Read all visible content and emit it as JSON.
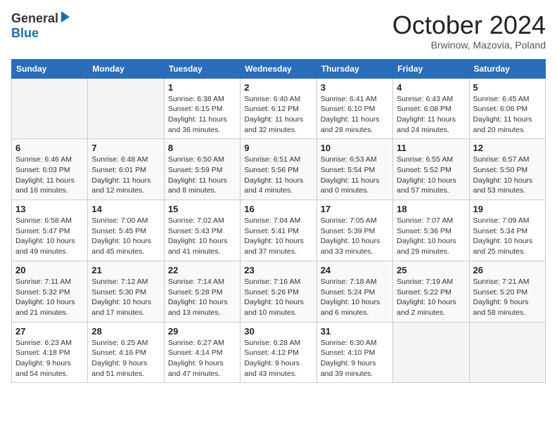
{
  "header": {
    "logo_general": "General",
    "logo_blue": "Blue",
    "month_title": "October 2024",
    "location": "Brwinow, Mazovia, Poland"
  },
  "days_of_week": [
    "Sunday",
    "Monday",
    "Tuesday",
    "Wednesday",
    "Thursday",
    "Friday",
    "Saturday"
  ],
  "weeks": [
    [
      {
        "day": "",
        "info": ""
      },
      {
        "day": "",
        "info": ""
      },
      {
        "day": "1",
        "info": "Sunrise: 6:38 AM\nSunset: 6:15 PM\nDaylight: 11 hours\nand 36 minutes."
      },
      {
        "day": "2",
        "info": "Sunrise: 6:40 AM\nSunset: 6:12 PM\nDaylight: 11 hours\nand 32 minutes."
      },
      {
        "day": "3",
        "info": "Sunrise: 6:41 AM\nSunset: 6:10 PM\nDaylight: 11 hours\nand 28 minutes."
      },
      {
        "day": "4",
        "info": "Sunrise: 6:43 AM\nSunset: 6:08 PM\nDaylight: 11 hours\nand 24 minutes."
      },
      {
        "day": "5",
        "info": "Sunrise: 6:45 AM\nSunset: 6:06 PM\nDaylight: 11 hours\nand 20 minutes."
      }
    ],
    [
      {
        "day": "6",
        "info": "Sunrise: 6:46 AM\nSunset: 6:03 PM\nDaylight: 11 hours\nand 16 minutes."
      },
      {
        "day": "7",
        "info": "Sunrise: 6:48 AM\nSunset: 6:01 PM\nDaylight: 11 hours\nand 12 minutes."
      },
      {
        "day": "8",
        "info": "Sunrise: 6:50 AM\nSunset: 5:59 PM\nDaylight: 11 hours\nand 8 minutes."
      },
      {
        "day": "9",
        "info": "Sunrise: 6:51 AM\nSunset: 5:56 PM\nDaylight: 11 hours\nand 4 minutes."
      },
      {
        "day": "10",
        "info": "Sunrise: 6:53 AM\nSunset: 5:54 PM\nDaylight: 11 hours\nand 0 minutes."
      },
      {
        "day": "11",
        "info": "Sunrise: 6:55 AM\nSunset: 5:52 PM\nDaylight: 10 hours\nand 57 minutes."
      },
      {
        "day": "12",
        "info": "Sunrise: 6:57 AM\nSunset: 5:50 PM\nDaylight: 10 hours\nand 53 minutes."
      }
    ],
    [
      {
        "day": "13",
        "info": "Sunrise: 6:58 AM\nSunset: 5:47 PM\nDaylight: 10 hours\nand 49 minutes."
      },
      {
        "day": "14",
        "info": "Sunrise: 7:00 AM\nSunset: 5:45 PM\nDaylight: 10 hours\nand 45 minutes."
      },
      {
        "day": "15",
        "info": "Sunrise: 7:02 AM\nSunset: 5:43 PM\nDaylight: 10 hours\nand 41 minutes."
      },
      {
        "day": "16",
        "info": "Sunrise: 7:04 AM\nSunset: 5:41 PM\nDaylight: 10 hours\nand 37 minutes."
      },
      {
        "day": "17",
        "info": "Sunrise: 7:05 AM\nSunset: 5:39 PM\nDaylight: 10 hours\nand 33 minutes."
      },
      {
        "day": "18",
        "info": "Sunrise: 7:07 AM\nSunset: 5:36 PM\nDaylight: 10 hours\nand 29 minutes."
      },
      {
        "day": "19",
        "info": "Sunrise: 7:09 AM\nSunset: 5:34 PM\nDaylight: 10 hours\nand 25 minutes."
      }
    ],
    [
      {
        "day": "20",
        "info": "Sunrise: 7:11 AM\nSunset: 5:32 PM\nDaylight: 10 hours\nand 21 minutes."
      },
      {
        "day": "21",
        "info": "Sunrise: 7:12 AM\nSunset: 5:30 PM\nDaylight: 10 hours\nand 17 minutes."
      },
      {
        "day": "22",
        "info": "Sunrise: 7:14 AM\nSunset: 5:28 PM\nDaylight: 10 hours\nand 13 minutes."
      },
      {
        "day": "23",
        "info": "Sunrise: 7:16 AM\nSunset: 5:26 PM\nDaylight: 10 hours\nand 10 minutes."
      },
      {
        "day": "24",
        "info": "Sunrise: 7:18 AM\nSunset: 5:24 PM\nDaylight: 10 hours\nand 6 minutes."
      },
      {
        "day": "25",
        "info": "Sunrise: 7:19 AM\nSunset: 5:22 PM\nDaylight: 10 hours\nand 2 minutes."
      },
      {
        "day": "26",
        "info": "Sunrise: 7:21 AM\nSunset: 5:20 PM\nDaylight: 9 hours\nand 58 minutes."
      }
    ],
    [
      {
        "day": "27",
        "info": "Sunrise: 6:23 AM\nSunset: 4:18 PM\nDaylight: 9 hours\nand 54 minutes."
      },
      {
        "day": "28",
        "info": "Sunrise: 6:25 AM\nSunset: 4:16 PM\nDaylight: 9 hours\nand 51 minutes."
      },
      {
        "day": "29",
        "info": "Sunrise: 6:27 AM\nSunset: 4:14 PM\nDaylight: 9 hours\nand 47 minutes."
      },
      {
        "day": "30",
        "info": "Sunrise: 6:28 AM\nSunset: 4:12 PM\nDaylight: 9 hours\nand 43 minutes."
      },
      {
        "day": "31",
        "info": "Sunrise: 6:30 AM\nSunset: 4:10 PM\nDaylight: 9 hours\nand 39 minutes."
      },
      {
        "day": "",
        "info": ""
      },
      {
        "day": "",
        "info": ""
      }
    ]
  ]
}
